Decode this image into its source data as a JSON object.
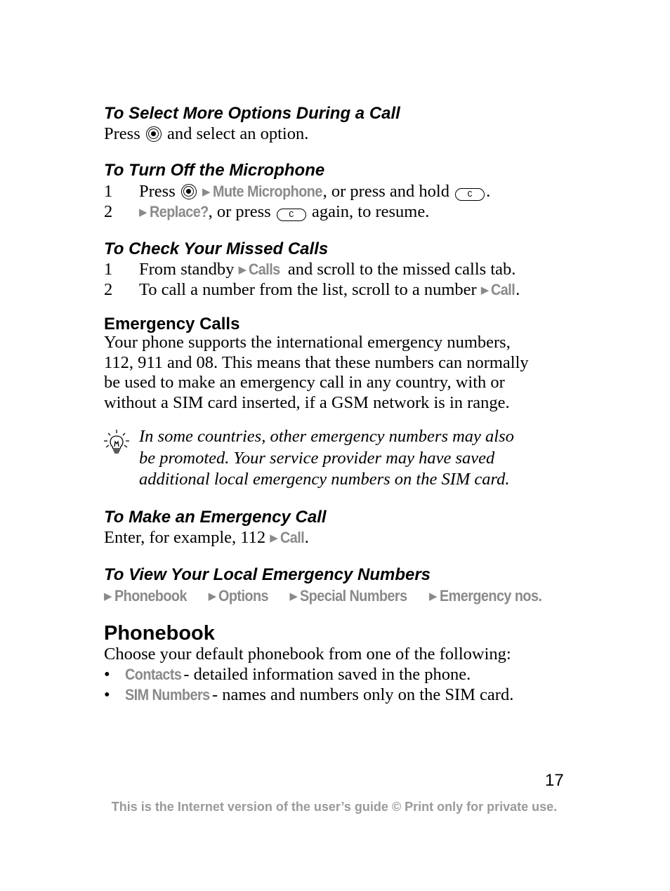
{
  "sections": {
    "select_options": {
      "heading": "To Select More Options During a Call",
      "text_before": "Press",
      "text_after": "and select an option."
    },
    "mute_mic": {
      "heading": "To Turn Off the Microphone",
      "steps": [
        {
          "num": "1",
          "pre": "Press",
          "menu": "Mute Microphone",
          "post": ", or press and hold",
          "end": "."
        },
        {
          "num": "2",
          "menu": "Replace?",
          "post": ", or press",
          "end": "again, to resume."
        }
      ]
    },
    "missed_calls": {
      "heading": "To Check Your Missed Calls",
      "steps": [
        {
          "num": "1",
          "pre": "From standby",
          "menu": "Calls",
          "post": "and scroll to the missed calls tab."
        },
        {
          "num": "2",
          "pre": "To call a number from the list, scroll to a number",
          "menu": "Call",
          "post": "."
        }
      ]
    },
    "emergency": {
      "heading": "Emergency Calls",
      "lines": [
        "Your phone supports the international emergency numbers,",
        "112, 911 and 08. This means that these numbers can normally",
        "be used to make an emergency call in any country, with or",
        "without a SIM card inserted, if a GSM network is in range."
      ],
      "note_icon": "lightbulb-icon",
      "note_lines": [
        "In some countries, other emergency numbers may also",
        "be promoted. Your service provider may have saved",
        "additional local emergency numbers on the SIM card."
      ]
    },
    "make_emergency": {
      "heading": "To Make an Emergency Call",
      "pre": "Enter, for example, 112",
      "menu": "Call",
      "post": "."
    },
    "view_local": {
      "heading": "To View Your Local Emergency Numbers",
      "path": [
        "Phonebook",
        "Options",
        "Special Numbers",
        "Emergency nos."
      ]
    },
    "phonebook": {
      "heading": "Phonebook",
      "intro": "Choose your default phonebook from one of the following:",
      "items": [
        {
          "bullet": "•",
          "menu": "Contacts",
          "text": "- detailed information saved in the phone."
        },
        {
          "bullet": "•",
          "menu": "SIM Numbers",
          "text": "- names and numbers only on the SIM card."
        }
      ]
    }
  },
  "keys": {
    "nav": "navigation-key-icon",
    "c": "C"
  },
  "arrow_glyph": "▶",
  "page_number": "17",
  "footer": "This is the Internet version of the user’s guide © Print only for private use.",
  "colors": {
    "menu_text": "#8a8a8a",
    "footer_text": "#9a9a9a"
  }
}
